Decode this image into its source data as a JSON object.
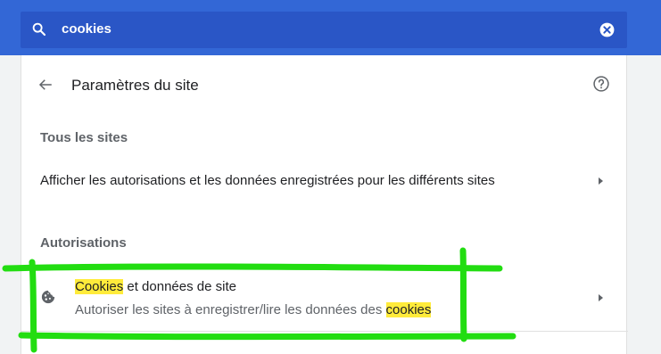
{
  "search": {
    "value": "cookies"
  },
  "header": {
    "title": "Paramètres du site"
  },
  "sections": {
    "all_sites": {
      "title": "Tous les sites",
      "row_label": "Afficher les autorisations et les données enregistrées pour les différents sites"
    },
    "permissions": {
      "title": "Autorisations",
      "cookies_row": {
        "primary_highlight": "Cookies",
        "primary_rest": " et données de site",
        "secondary_rest": "Autoriser les sites à enregistrer/lire les données des ",
        "secondary_highlight": "cookies"
      }
    }
  },
  "colors": {
    "toolbar": "#3367d6",
    "search_field": "#2a56c6",
    "highlight": "#ffeb3b",
    "annotation_marker": "#22dd11"
  },
  "icons": [
    "search-icon",
    "clear-search-icon",
    "back-arrow-icon",
    "help-icon",
    "cookie-icon",
    "chevron-right-icon"
  ]
}
